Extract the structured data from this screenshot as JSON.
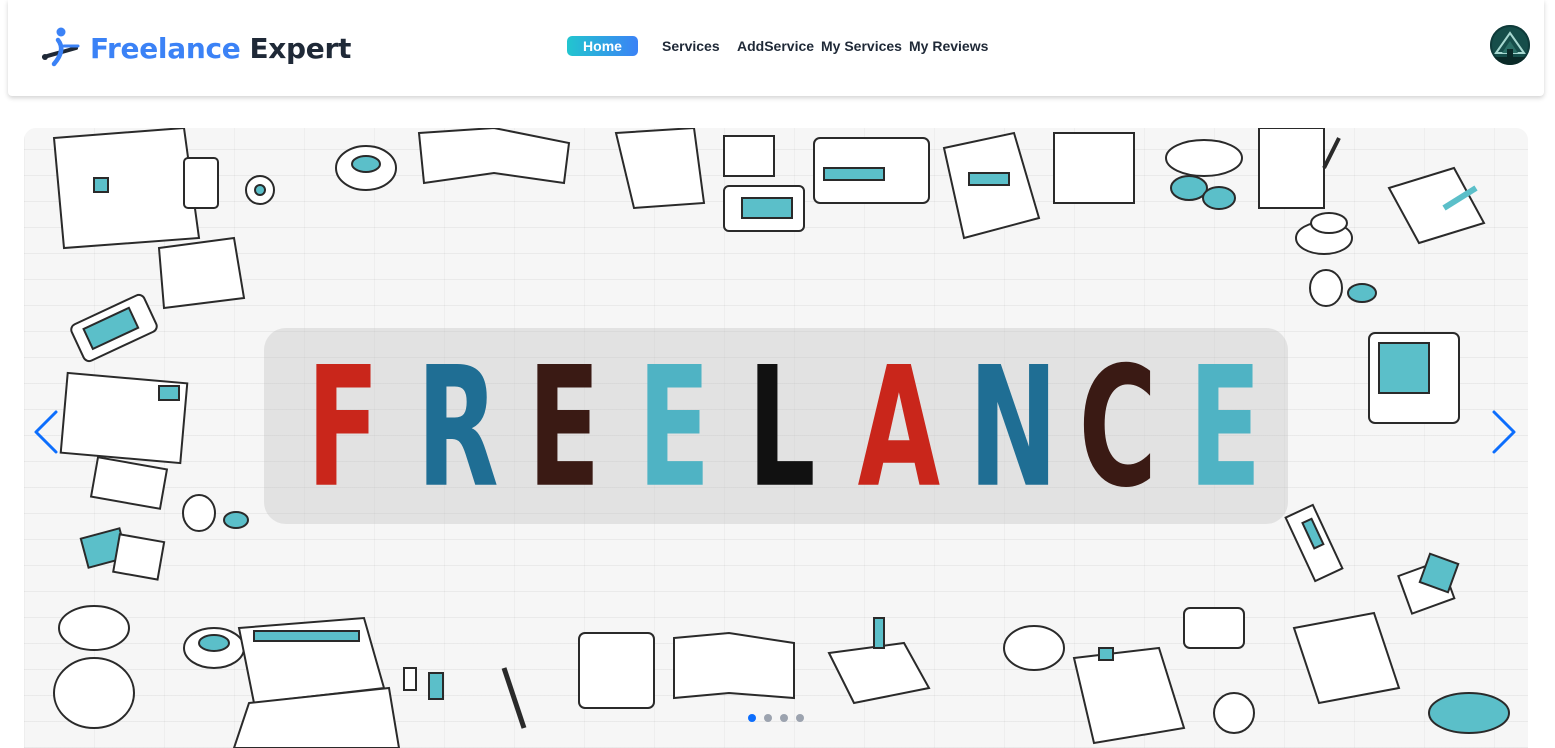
{
  "brand": {
    "name_part1": "Freelance",
    "name_part2": "Expert"
  },
  "nav": {
    "items": [
      {
        "label": "Home",
        "active": true
      },
      {
        "label": "Services",
        "active": false
      },
      {
        "label": "AddService",
        "active": false
      },
      {
        "label": "My Services",
        "active": false
      },
      {
        "label": "My Reviews",
        "active": false
      }
    ]
  },
  "user": {
    "avatar_icon": "user-avatar"
  },
  "carousel": {
    "slide_word": "FREELANCE",
    "letters": [
      {
        "char": "F",
        "color": "#c9261b"
      },
      {
        "char": "R",
        "color": "#1f6e94"
      },
      {
        "char": "E",
        "color": "#3a1a14"
      },
      {
        "char": "E",
        "color": "#4fb3c4"
      },
      {
        "char": "L",
        "color": "#111111"
      },
      {
        "char": "A",
        "color": "#c9261b"
      },
      {
        "char": "N",
        "color": "#1f6e94"
      },
      {
        "char": "C",
        "color": "#3a1a14"
      },
      {
        "char": "E",
        "color": "#4fb3c4"
      }
    ],
    "prev_icon": "chevron-left-icon",
    "next_icon": "chevron-right-icon",
    "slide_count": 4,
    "active_slide": 1
  },
  "colors": {
    "accent": "#3b82f6",
    "active_gradient_start": "#22c5cf",
    "arrow": "#0d6efd"
  }
}
